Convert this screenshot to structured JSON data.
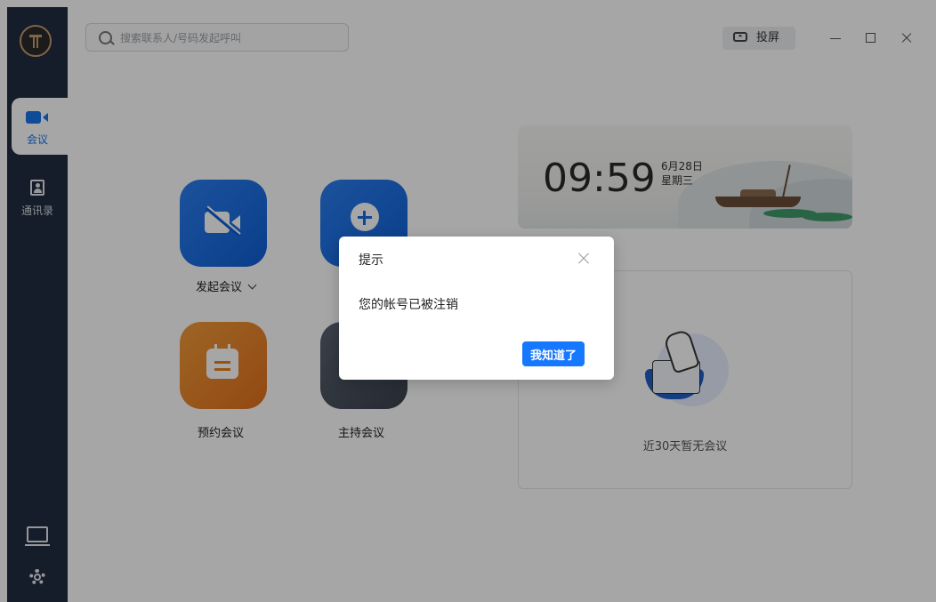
{
  "search": {
    "placeholder": "搜索联系人/号码发起呼叫"
  },
  "topbar": {
    "cast_label": "投屏"
  },
  "sidebar": {
    "items": [
      {
        "label": "会议",
        "icon": "video-camera-icon",
        "active": true
      },
      {
        "label": "通讯录",
        "icon": "contacts-book-icon",
        "active": false
      }
    ],
    "bottom_icons": [
      "monitor-chart-icon",
      "gear-icon"
    ]
  },
  "actions": {
    "start_label": "发起会议",
    "schedule_label": "预约会议",
    "host_label": "主持会议"
  },
  "clock": {
    "time": "09:59",
    "date": "6月28日",
    "weekday": "星期三"
  },
  "recent": {
    "empty_text": "近30天暂无会议"
  },
  "dialog": {
    "title": "提示",
    "message": "您的帐号已被注销",
    "confirm_label": "我知道了"
  },
  "colors": {
    "accent": "#1677ff",
    "sidebar": "#1f2d40",
    "logo_gold": "#c69c6d"
  }
}
